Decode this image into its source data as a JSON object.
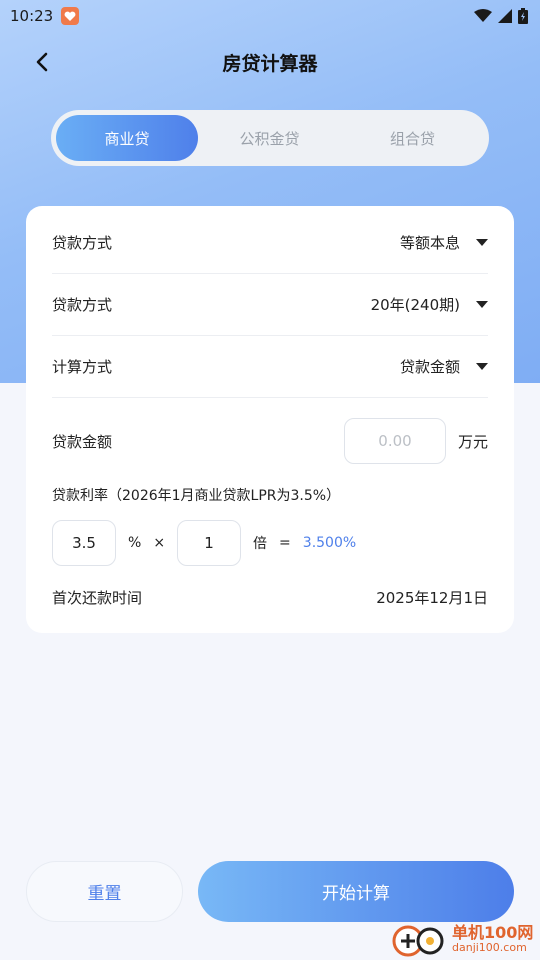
{
  "status_bar": {
    "time": "10:23"
  },
  "header": {
    "title": "房贷计算器"
  },
  "tabs": [
    {
      "label": "商业贷",
      "active": true
    },
    {
      "label": "公积金贷",
      "active": false
    },
    {
      "label": "组合贷",
      "active": false
    }
  ],
  "form": {
    "repay_method": {
      "label": "贷款方式",
      "value": "等额本息"
    },
    "loan_term": {
      "label": "贷款方式",
      "value": "20年(240期)"
    },
    "calc_method": {
      "label": "计算方式",
      "value": "贷款金额"
    },
    "loan_amount": {
      "label": "贷款金额",
      "placeholder": "0.00",
      "unit": "万元"
    },
    "rate": {
      "title": "贷款利率（2026年1月商业贷款LPR为3.5%）",
      "base": "3.5",
      "percent_sym": "%",
      "times_sym": "×",
      "multiplier": "1",
      "multiplier_unit": "倍",
      "equals_sym": "=",
      "result": "3.500%"
    },
    "first_payment": {
      "label": "首次还款时间",
      "value": "2025年12月1日"
    }
  },
  "buttons": {
    "reset": "重置",
    "start": "开始计算"
  },
  "watermark": {
    "main": "单机100网",
    "sub": "danji100.com"
  },
  "colors": {
    "accent": "#4f80ea",
    "hero_top": "#b4d2fb",
    "hero_bottom": "#7fadf4",
    "brand_orange": "#e0642e"
  }
}
